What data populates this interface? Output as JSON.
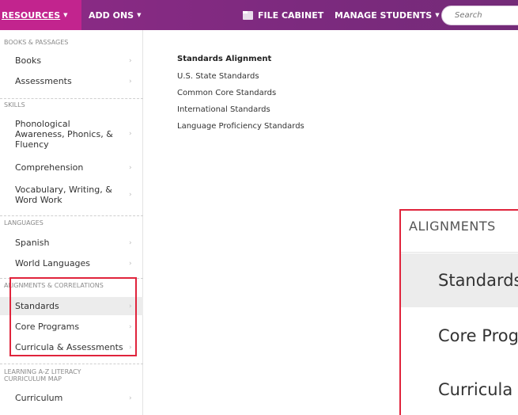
{
  "nav": {
    "resources": "RESOURCES",
    "add_ons": "ADD ONS",
    "file_cabinet": "FILE CABINET",
    "manage_students": "MANAGE STUDENTS",
    "search_placeholder": "Search",
    "caret": "▼"
  },
  "sidebar": {
    "sections": [
      {
        "heading": "BOOKS & PASSAGES",
        "items": [
          "Books",
          "Assessments"
        ]
      },
      {
        "heading": "SKILLS",
        "items": [
          "Phonological Awareness, Phonics, & Fluency",
          "Comprehension",
          "Vocabulary, Writing, & Word Work"
        ]
      },
      {
        "heading": "LANGUAGES",
        "items": [
          "Spanish",
          "World Languages"
        ]
      },
      {
        "heading": "ALIGNMENTS & CORRELATIONS",
        "items": [
          "Standards",
          "Core Programs",
          "Curricula & Assessments"
        ]
      },
      {
        "heading": "LEARNING A-Z LITERACY CURRICULUM MAP",
        "items": [
          "Curriculum"
        ]
      }
    ],
    "chevron": "›"
  },
  "main": {
    "title": "Standards Alignment",
    "links": [
      "U.S. State Standards",
      "Common Core Standards",
      "International Standards",
      "Language Proficiency Standards"
    ]
  },
  "zoom": {
    "heading": "ALIGNMENTS",
    "items": [
      "Standards",
      "Core Programs",
      "Curricula"
    ]
  }
}
